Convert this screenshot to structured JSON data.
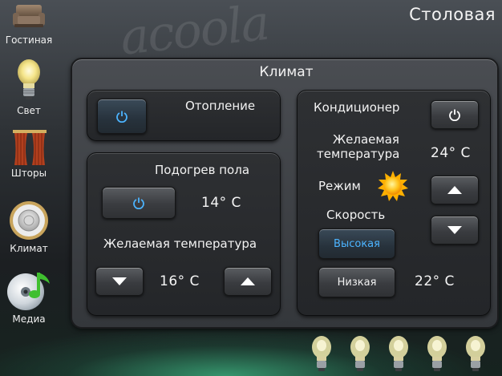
{
  "header": {
    "room_title": "Столовая",
    "watermark": "acoola"
  },
  "sidebar": {
    "items": [
      {
        "label": "Гостиная",
        "icon": "sofa-icon"
      },
      {
        "label": "Свет",
        "icon": "light-bulb-icon"
      },
      {
        "label": "Шторы",
        "icon": "curtains-icon"
      },
      {
        "label": "Климат",
        "icon": "thermostat-icon",
        "selected": true
      },
      {
        "label": "Медиа",
        "icon": "media-disc-icon"
      }
    ]
  },
  "panel": {
    "title": "Климат",
    "heating": {
      "label": "Отопление",
      "power_icon": "power-icon"
    },
    "floor_heating": {
      "title": "Подогрев пола",
      "current_temp": "14° C",
      "desired_label": "Желаемая температура",
      "desired_temp": "16° C",
      "power_icon": "power-icon"
    },
    "ac": {
      "title": "Кондиционер",
      "desired_label_line1": "Желаемая",
      "desired_label_line2": "температура",
      "desired_temp": "24° C",
      "mode_label": "Режим",
      "mode_icon": "sun-icon",
      "speed_label": "Скорость",
      "speed_high": "Высокая",
      "speed_low": "Низкая",
      "current_temp": "22° C",
      "selected_speed": "Высокая",
      "power_icon": "power-icon"
    }
  },
  "bottom_bar": {
    "bulb_count": 5
  },
  "colors": {
    "accent": "#4cb4ff",
    "glow": "#46d296"
  }
}
